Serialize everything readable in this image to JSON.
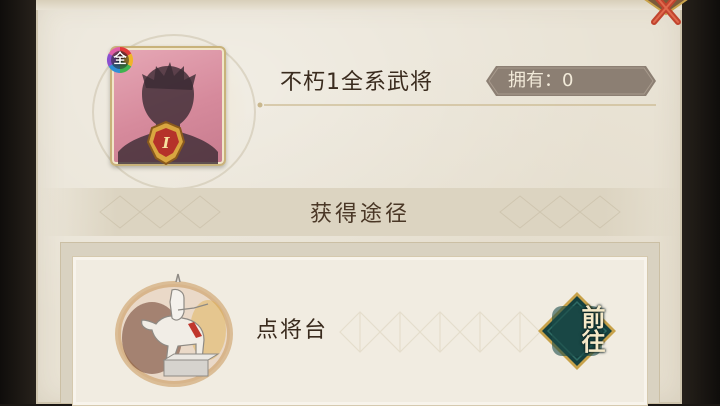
{
  "general": {
    "name": "不朽1全系武将",
    "element_badge": "全",
    "rank": "I",
    "portrait_icon": "silhouette-portrait"
  },
  "ownership": {
    "text": "拥有：0"
  },
  "section": {
    "title": "获得途径"
  },
  "sources": [
    {
      "label": "点将台",
      "icon": "statue-horseman-icon",
      "button_label": "前往"
    }
  ],
  "colors": {
    "panel": "#e9e3d5",
    "portrait_bg": "#d68a9c",
    "own_plate": "#8c7f73",
    "go_button": "#15403f",
    "gold": "#c8a24a"
  }
}
